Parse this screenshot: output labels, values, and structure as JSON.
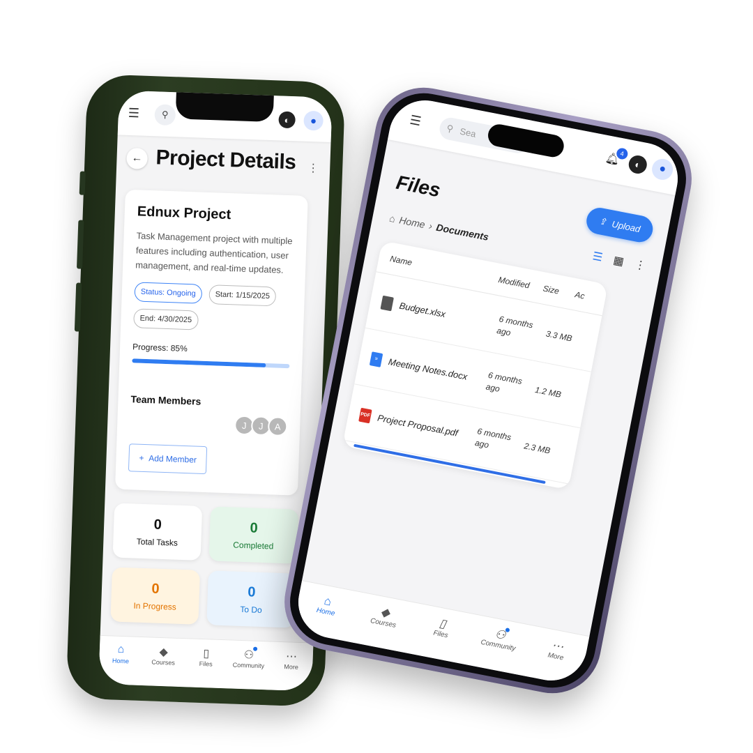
{
  "phone_left": {
    "header": {
      "title": "Project Details"
    },
    "project": {
      "name": "Ednux Project",
      "description": "Task Management project with multiple features including authentication, user management, and real-time updates.",
      "status_chip": "Status: Ongoing",
      "start_chip": "Start: 1/15/2025",
      "end_chip": "End: 4/30/2025",
      "progress_label": "Progress: 85%",
      "progress_value": 85,
      "team_label": "Team Members",
      "team_avatars": [
        "J",
        "J",
        "A"
      ],
      "add_member_label": "Add Member"
    },
    "stats": [
      {
        "value": "0",
        "label": "Total Tasks",
        "color": "#111111"
      },
      {
        "value": "0",
        "label": "Completed",
        "color": "#1a7a36"
      },
      {
        "value": "0",
        "label": "In Progress",
        "color": "#e37400"
      },
      {
        "value": "0",
        "label": "To Do",
        "color": "#1a7ad6"
      }
    ],
    "nav": [
      {
        "label": "Home",
        "icon": "home-icon",
        "active": true
      },
      {
        "label": "Courses",
        "icon": "graduation-cap-icon",
        "active": false
      },
      {
        "label": "Files",
        "icon": "book-icon",
        "active": false
      },
      {
        "label": "Community",
        "icon": "people-icon",
        "active": false,
        "dot": true
      },
      {
        "label": "More",
        "icon": "more-icon",
        "active": false
      }
    ]
  },
  "phone_right": {
    "search": {
      "placeholder": "Sea"
    },
    "notifications_count": "4",
    "page_title": "Files",
    "upload_label": "Upload",
    "breadcrumb": {
      "home": "Home",
      "separator": "›",
      "current": "Documents"
    },
    "table": {
      "headers": {
        "name": "Name",
        "modified": "Modified",
        "size": "Size",
        "actions": "Ac"
      },
      "rows": [
        {
          "name": "Budget.xlsx",
          "type": "xlsx",
          "modified": "6 months ago",
          "size": "3.3 MB"
        },
        {
          "name": "Meeting Notes.docx",
          "type": "docx",
          "modified": "6 months ago",
          "size": "1.2 MB"
        },
        {
          "name": "Project Proposal.pdf",
          "type": "pdf",
          "modified": "6 months ago",
          "size": "2.3 MB"
        }
      ]
    },
    "nav": [
      {
        "label": "Home",
        "icon": "home-icon",
        "active": true
      },
      {
        "label": "Courses",
        "icon": "graduation-cap-icon",
        "active": false
      },
      {
        "label": "Files",
        "icon": "book-icon",
        "active": false
      },
      {
        "label": "Community",
        "icon": "people-icon",
        "active": false,
        "dot": true
      },
      {
        "label": "More",
        "icon": "more-icon",
        "active": false
      }
    ]
  },
  "colors": {
    "accent": "#2f7cf1",
    "left_phone_frame": "#2c3d22",
    "right_phone_frame": "#a89fc4"
  }
}
